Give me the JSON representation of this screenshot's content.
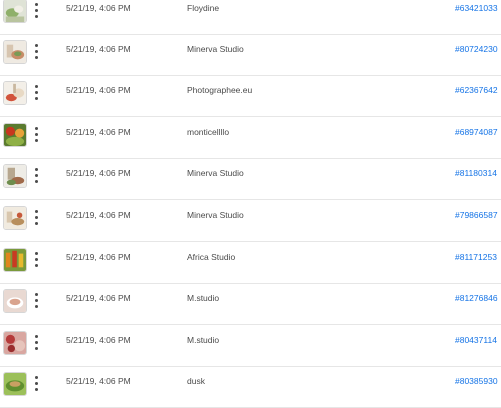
{
  "colors": {
    "link": "#1473e6",
    "text": "#4b4b4b",
    "divider": "#e6e6e6"
  },
  "rows": [
    {
      "thumb": "food-photo-thumbnail",
      "date": "5/21/19, 4:06 PM",
      "author": "Floydine",
      "asset_id": "#63421033"
    },
    {
      "thumb": "food-photo-thumbnail",
      "date": "5/21/19, 4:06 PM",
      "author": "Minerva Studio",
      "asset_id": "#80724230"
    },
    {
      "thumb": "food-photo-thumbnail",
      "date": "5/21/19, 4:06 PM",
      "author": "Photographee.eu",
      "asset_id": "#62367642"
    },
    {
      "thumb": "food-photo-thumbnail",
      "date": "5/21/19, 4:06 PM",
      "author": "monticellllo",
      "asset_id": "#68974087"
    },
    {
      "thumb": "food-photo-thumbnail",
      "date": "5/21/19, 4:06 PM",
      "author": "Minerva Studio",
      "asset_id": "#81180314"
    },
    {
      "thumb": "food-photo-thumbnail",
      "date": "5/21/19, 4:06 PM",
      "author": "Minerva Studio",
      "asset_id": "#79866587"
    },
    {
      "thumb": "food-photo-thumbnail",
      "date": "5/21/19, 4:06 PM",
      "author": "Africa Studio",
      "asset_id": "#81171253"
    },
    {
      "thumb": "food-photo-thumbnail",
      "date": "5/21/19, 4:06 PM",
      "author": "M.studio",
      "asset_id": "#81276846"
    },
    {
      "thumb": "food-photo-thumbnail",
      "date": "5/21/19, 4:06 PM",
      "author": "M.studio",
      "asset_id": "#80437114"
    },
    {
      "thumb": "food-photo-thumbnail",
      "date": "5/21/19, 4:06 PM",
      "author": "dusk",
      "asset_id": "#80385930"
    }
  ]
}
